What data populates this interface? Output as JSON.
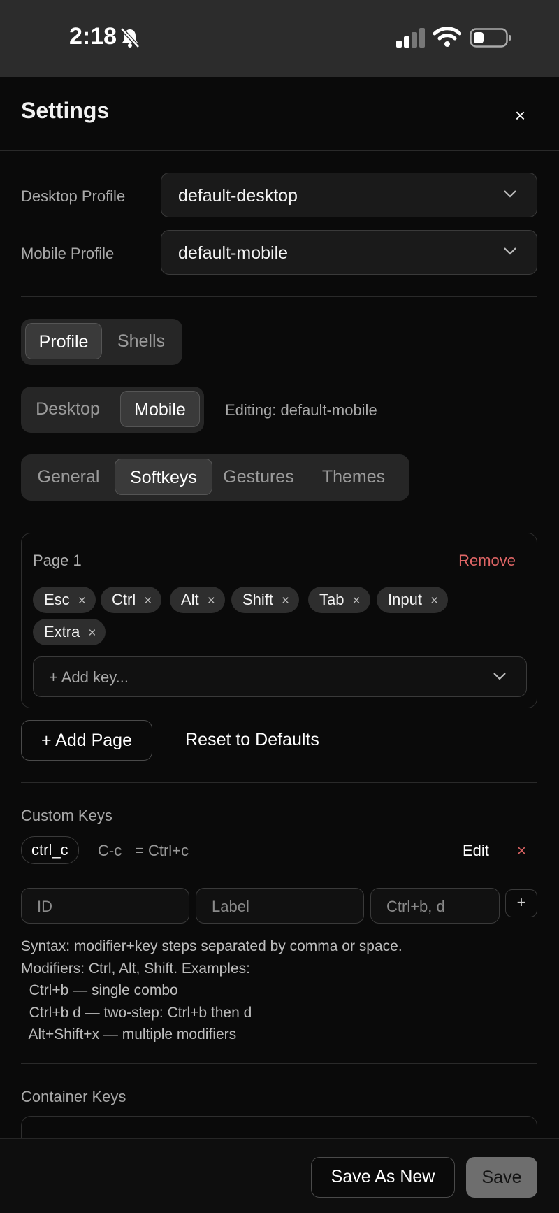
{
  "status": {
    "time": "2:18"
  },
  "header": {
    "title": "Settings",
    "close": "×"
  },
  "profiles": {
    "desktop_label": "Desktop Profile",
    "desktop_value": "default-desktop",
    "mobile_label": "Mobile Profile",
    "mobile_value": "default-mobile"
  },
  "tabs_top": [
    {
      "label": "Profile",
      "active": true
    },
    {
      "label": "Shells",
      "active": false
    }
  ],
  "device_tabs": [
    {
      "label": "Desktop",
      "active": false
    },
    {
      "label": "Mobile",
      "active": true
    }
  ],
  "editing": "Editing: default-mobile",
  "sub_tabs": [
    {
      "label": "General",
      "active": false
    },
    {
      "label": "Softkeys",
      "active": true
    },
    {
      "label": "Gestures",
      "active": false
    },
    {
      "label": "Themes",
      "active": false
    }
  ],
  "page_card": {
    "label": "Page 1",
    "remove": "Remove",
    "keys": [
      "Esc",
      "Ctrl",
      "Alt",
      "Shift",
      "Tab",
      "Input",
      "Extra"
    ],
    "remove_glyph": "×",
    "add_key_placeholder": "+ Add key..."
  },
  "actions": {
    "add_page": "+ Add Page",
    "reset": "Reset to Defaults"
  },
  "custom_keys": {
    "heading": "Custom Keys",
    "item": {
      "id": "ctrl_c",
      "label": "C-c",
      "seq": "= Ctrl+c",
      "edit": "Edit",
      "delete": "×"
    },
    "id_placeholder": "ID",
    "label_placeholder": "Label",
    "seq_placeholder": "Ctrl+b, d",
    "add": "+",
    "help": "Syntax: modifier+key steps separated by comma or space.\nModifiers: Ctrl, Alt, Shift. Examples:\n  Ctrl+b — single combo\n  Ctrl+b d — two-step: Ctrl+b then d\n  Alt+Shift+x — multiple modifiers"
  },
  "container_keys": {
    "heading": "Container Keys"
  },
  "footer": {
    "save_as_new": "Save As New",
    "save": "Save"
  }
}
